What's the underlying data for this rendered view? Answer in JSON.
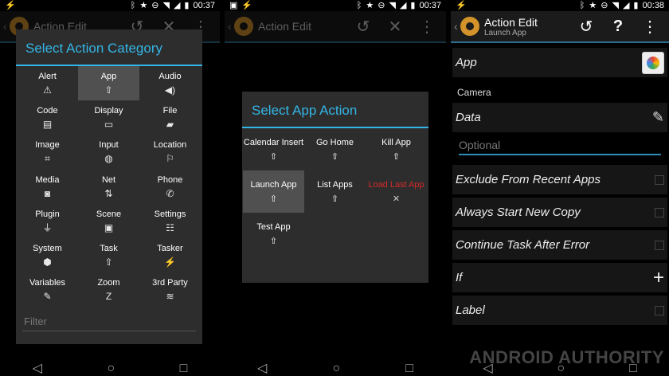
{
  "panels": [
    {
      "status": {
        "time": "00:37"
      },
      "actionbar": {
        "title": "Action Edit"
      },
      "dialog": {
        "title": "Select Action Category",
        "filter_placeholder": "Filter",
        "items": [
          {
            "label": "Alert",
            "icon": "warning-icon"
          },
          {
            "label": "App",
            "icon": "rocket-icon"
          },
          {
            "label": "Audio",
            "icon": "speaker-icon"
          },
          {
            "label": "Code",
            "icon": "code-icon"
          },
          {
            "label": "Display",
            "icon": "monitor-icon"
          },
          {
            "label": "File",
            "icon": "folder-icon"
          },
          {
            "label": "Image",
            "icon": "crop-icon"
          },
          {
            "label": "Input",
            "icon": "mouse-icon"
          },
          {
            "label": "Location",
            "icon": "flag-icon"
          },
          {
            "label": "Media",
            "icon": "camera-icon"
          },
          {
            "label": "Net",
            "icon": "network-icon"
          },
          {
            "label": "Phone",
            "icon": "phone-icon"
          },
          {
            "label": "Plugin",
            "icon": "plug-icon"
          },
          {
            "label": "Scene",
            "icon": "picture-icon"
          },
          {
            "label": "Settings",
            "icon": "sliders-icon"
          },
          {
            "label": "System",
            "icon": "android-icon"
          },
          {
            "label": "Task",
            "icon": "rocket-icon"
          },
          {
            "label": "Tasker",
            "icon": "bolt-icon"
          },
          {
            "label": "Variables",
            "icon": "tag-icon"
          },
          {
            "label": "Zoom",
            "icon": "zoom-icon"
          },
          {
            "label": "3rd Party",
            "icon": "stack-icon"
          }
        ],
        "selected": "App"
      }
    },
    {
      "status": {
        "time": "00:37"
      },
      "actionbar": {
        "title": "Action Edit"
      },
      "dialog": {
        "title": "Select App Action",
        "items": [
          {
            "label": "Calendar Insert",
            "icon": "rocket-icon"
          },
          {
            "label": "Go Home",
            "icon": "rocket-icon"
          },
          {
            "label": "Kill App",
            "icon": "rocket-icon"
          },
          {
            "label": "Launch App",
            "icon": "rocket-icon"
          },
          {
            "label": "List Apps",
            "icon": "rocket-icon"
          },
          {
            "label": "Load Last App",
            "icon": "close-icon"
          },
          {
            "label": "Test App",
            "icon": "rocket-icon"
          }
        ],
        "selected": "Launch App",
        "disabled": "Load Last App"
      }
    },
    {
      "status": {
        "time": "00:38"
      },
      "actionbar": {
        "title": "Action Edit",
        "subtitle": "Launch App",
        "help": "?"
      },
      "rows": {
        "app": "App",
        "app_value": "Camera",
        "data": "Data",
        "optional_placeholder": "Optional",
        "exclude": "Exclude From Recent Apps",
        "always_new": "Always Start New Copy",
        "continue": "Continue Task After Error",
        "if": "If",
        "label": "Label"
      },
      "watermark": "ANDROID AUTHORITY"
    }
  ],
  "colors": {
    "accent": "#33b5e5",
    "selected_bg": "#505050",
    "disabled_text": "#d42a2a"
  }
}
